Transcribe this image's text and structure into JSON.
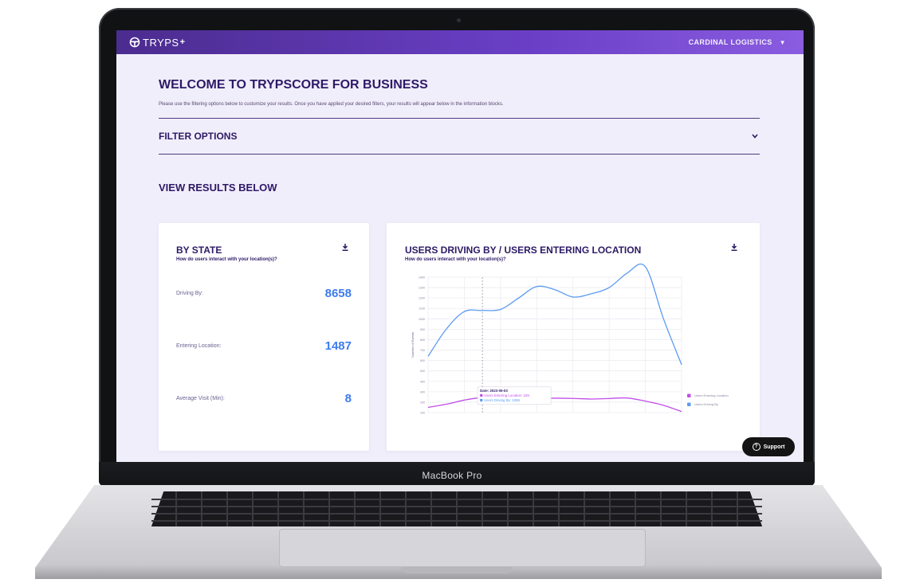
{
  "device": {
    "label": "MacBook Pro"
  },
  "topbar": {
    "logo_text": "TRYPS",
    "logo_mark": "+",
    "account": "CARDINAL LOGISTICS"
  },
  "page": {
    "title": "WELCOME TO TRYPSCORE FOR BUSINESS",
    "intro": "Please use the filtering options below to customize your results. Once you have applied your desired filters, your results will appear below in the information blocks.",
    "filter_label": "FILTER OPTIONS",
    "results_title": "VIEW RESULTS BELOW"
  },
  "state_card": {
    "title": "BY STATE",
    "subtitle": "How do users interact with your location(s)?",
    "stats": [
      {
        "label": "Driving By:",
        "value": "8658"
      },
      {
        "label": "Entering Location:",
        "value": "1487"
      },
      {
        "label": "Average Visit (Min):",
        "value": "8"
      }
    ]
  },
  "chart_card": {
    "title": "USERS DRIVING BY / USERS ENTERING LOCATION",
    "subtitle": "How do users interact with your location(s)?"
  },
  "support": {
    "label": "Support"
  },
  "colors": {
    "accent": "#6a3fc6",
    "value_blue": "#3d7cf0",
    "entering": "#c14ee8",
    "driving": "#5b9bf0"
  },
  "chart_data": {
    "type": "line",
    "ylabel": "Number of Events",
    "xlabel": "",
    "title": "USERS DRIVING BY / USERS ENTERING LOCATION",
    "yticks": [
      100,
      200,
      300,
      400,
      500,
      600,
      700,
      800,
      900,
      1000,
      1100,
      1200,
      1300,
      1400
    ],
    "ylim": [
      100,
      1400
    ],
    "grid": true,
    "legend": "right",
    "x": [
      0,
      1,
      2,
      3,
      4,
      5,
      6,
      7,
      8,
      9,
      10,
      11,
      12,
      13,
      14
    ],
    "series": [
      {
        "name": "Users Entering Location",
        "color": "#c14ee8",
        "values": [
          150,
          180,
          220,
          245,
          238,
          228,
          232,
          238,
          236,
          230,
          235,
          240,
          210,
          170,
          110
        ]
      },
      {
        "name": "Users Driving By",
        "color": "#5b9bf0",
        "values": [
          640,
          900,
          1070,
          1080,
          1090,
          1200,
          1310,
          1280,
          1210,
          1240,
          1300,
          1440,
          1500,
          1000,
          560
        ]
      }
    ],
    "tooltip": {
      "date": "Date: 2023-05-03",
      "lines": [
        "Users Entering Location: 228",
        "Users Driving By: 1086"
      ],
      "index": 3
    }
  }
}
